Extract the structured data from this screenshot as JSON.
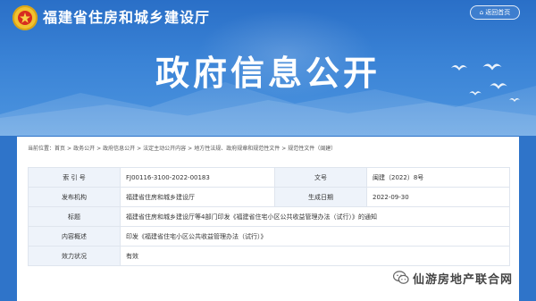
{
  "header": {
    "site_title": "福建省住房和城乡建设厅",
    "back_button": "返回首页",
    "hero_title": "政府信息公开"
  },
  "breadcrumb": {
    "prefix": "当前位置：",
    "items": [
      "首页",
      "政务公开",
      "政府信息公开",
      "法定主动公开内容",
      "地方性法规、政府规章和规范性文件",
      "规范性文件（闽建）"
    ],
    "separator": ">"
  },
  "info": {
    "index_label": "索 引 号",
    "index_value": "FJ00116-3100-2022-00183",
    "doc_no_label": "文号",
    "doc_no_value": "闽建（2022）8号",
    "publisher_label": "发布机构",
    "publisher_value": "福建省住房和城乡建设厅",
    "date_label": "生成日期",
    "date_value": "2022-09-30",
    "title_label": "标题",
    "title_value": "福建省住房和城乡建设厅等4部门印发《福建省住宅小区公共收益管理办法（试行）》的通知",
    "summary_label": "内容概述",
    "summary_value": "印发《福建省住宅小区公共收益管理办法（试行）》",
    "validity_label": "效力状况",
    "validity_value": "有效"
  },
  "watermark": {
    "text": "仙游房地产联合网",
    "icon": "wechat-icon"
  },
  "colors": {
    "banner": "#2f74c9",
    "label_bg": "#eef3fa",
    "emblem": "#f2c230"
  }
}
